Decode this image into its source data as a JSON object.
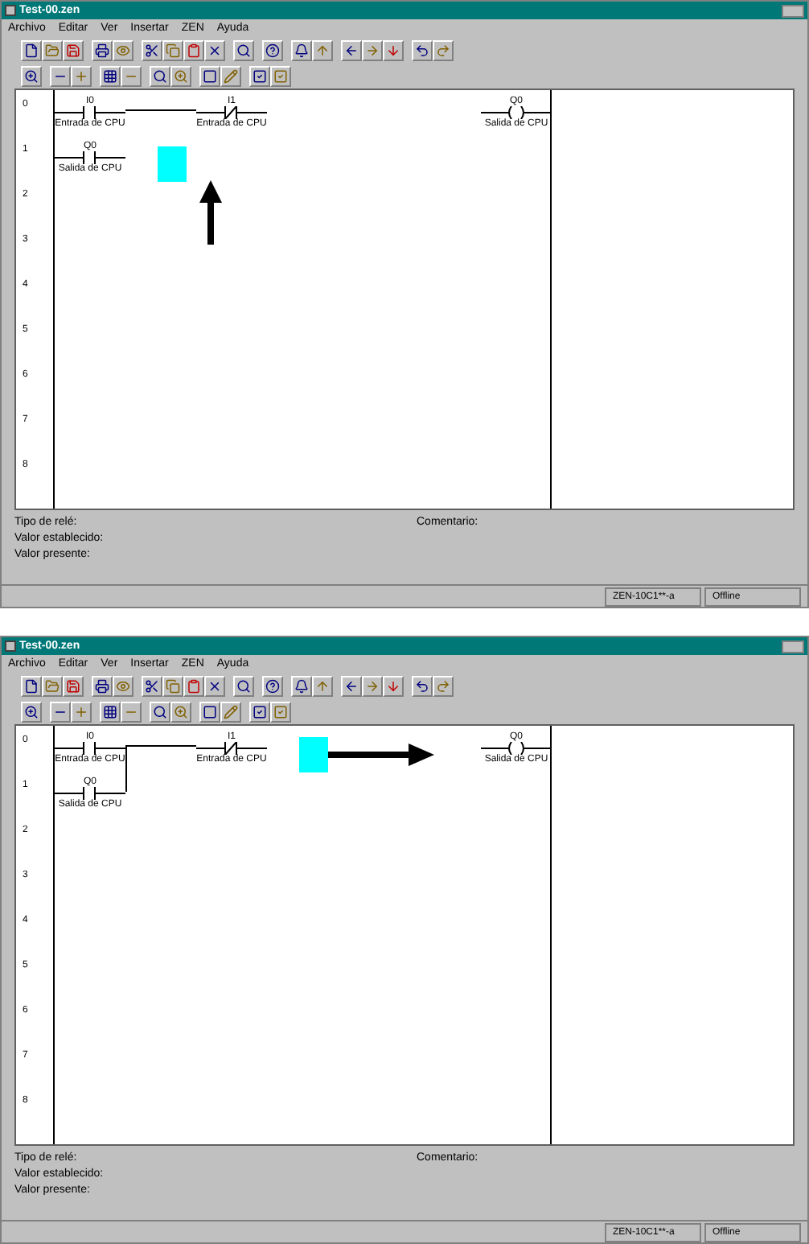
{
  "screens": [
    {
      "title": "Test-00.zen",
      "menu": [
        "Archivo",
        "Editar",
        "Ver",
        "Insertar",
        "ZEN",
        "Ayuda"
      ],
      "rows": [
        {
          "number": "0",
          "cells": [
            {
              "kind": "contact_no",
              "address": "I0",
              "comment": "Entrada de CPU"
            },
            {
              "kind": "wire"
            },
            {
              "kind": "contact_nc",
              "address": "I1",
              "comment": "Entrada de CPU"
            },
            {
              "kind": "empty"
            },
            {
              "kind": "empty"
            },
            {
              "kind": "empty"
            },
            {
              "kind": "coil",
              "address": "Q0",
              "comment": "Salida de CPU"
            }
          ]
        },
        {
          "number": "1",
          "cells": [
            {
              "kind": "contact_no",
              "address": "Q0",
              "comment": "Salida de CPU"
            },
            {
              "kind": "cursor"
            },
            {
              "kind": "arrow_up"
            },
            {
              "kind": "empty"
            },
            {
              "kind": "empty"
            },
            {
              "kind": "empty"
            },
            {
              "kind": "empty"
            }
          ]
        },
        {
          "number": "2",
          "cells": []
        },
        {
          "number": "3",
          "cells": []
        },
        {
          "number": "4",
          "cells": []
        },
        {
          "number": "5",
          "cells": []
        },
        {
          "number": "6",
          "cells": []
        },
        {
          "number": "7",
          "cells": []
        },
        {
          "number": "8",
          "cells": []
        }
      ],
      "info": [
        "Tipo de relé:",
        "Valor establecido:",
        "Valor presente:"
      ],
      "comment_label": "Comentario:",
      "status": [
        "ZEN-10C1**-a",
        "Offline"
      ]
    },
    {
      "title": "Test-00.zen",
      "menu": [
        "Archivo",
        "Editar",
        "Ver",
        "Insertar",
        "ZEN",
        "Ayuda"
      ],
      "rows": [
        {
          "number": "0",
          "cells": [
            {
              "kind": "contact_no",
              "address": "I0",
              "comment": "Entrada de CPU"
            },
            {
              "kind": "wire",
              "branch": true
            },
            {
              "kind": "contact_nc",
              "address": "I1",
              "comment": "Entrada de CPU"
            },
            {
              "kind": "cursor"
            },
            {
              "kind": "arrow_right"
            },
            {
              "kind": "empty"
            },
            {
              "kind": "coil",
              "address": "Q0",
              "comment": "Salida de CPU"
            }
          ]
        },
        {
          "number": "1",
          "cells": [
            {
              "kind": "contact_no",
              "address": "Q0",
              "comment": "Salida de CPU"
            },
            {
              "kind": "empty"
            },
            {
              "kind": "empty"
            },
            {
              "kind": "empty"
            },
            {
              "kind": "empty"
            },
            {
              "kind": "empty"
            },
            {
              "kind": "empty"
            }
          ]
        },
        {
          "number": "2",
          "cells": []
        },
        {
          "number": "3",
          "cells": []
        },
        {
          "number": "4",
          "cells": []
        },
        {
          "number": "5",
          "cells": []
        },
        {
          "number": "6",
          "cells": []
        },
        {
          "number": "7",
          "cells": []
        },
        {
          "number": "8",
          "cells": []
        }
      ],
      "info": [
        "Tipo de relé:",
        "Valor establecido:",
        "Valor presente:"
      ],
      "comment_label": "Comentario:",
      "status": [
        "ZEN-10C1**-a",
        "Offline"
      ]
    }
  ]
}
